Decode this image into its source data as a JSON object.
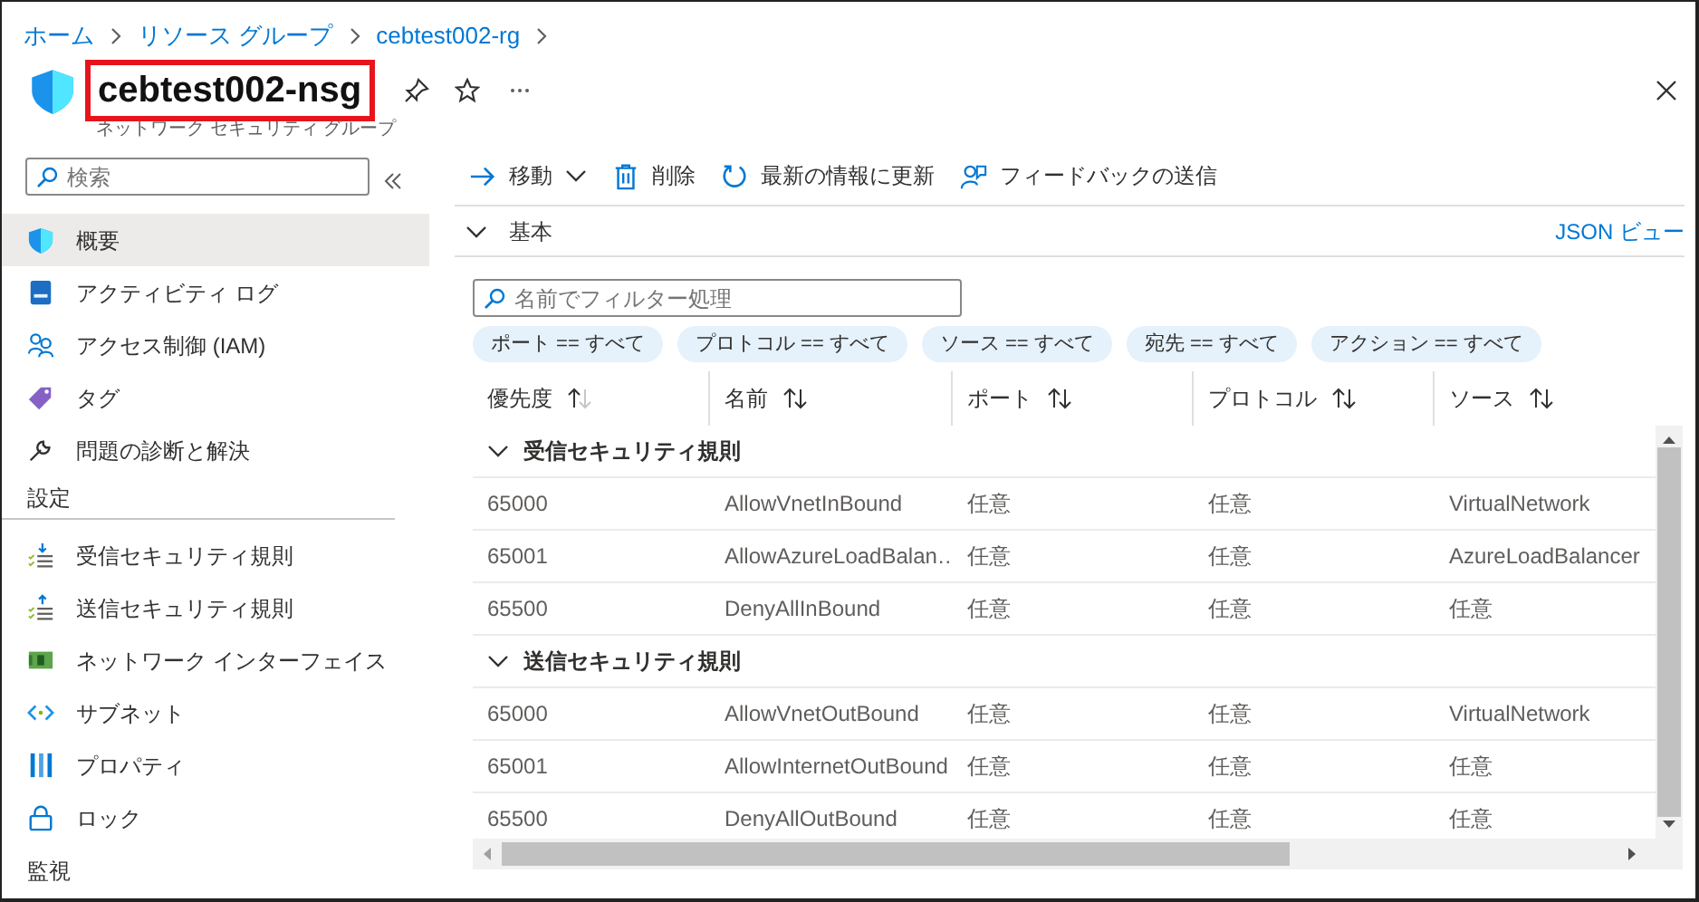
{
  "breadcrumb": [
    "ホーム",
    "リソース グループ",
    "cebtest002-rg"
  ],
  "header": {
    "title": "cebtest002-nsg",
    "subtitle": "ネットワーク セキュリティ グループ",
    "highlighted": true
  },
  "sidebar": {
    "search": {
      "placeholder": "検索"
    },
    "items": [
      {
        "kind": "item",
        "label": "概要",
        "selected": true
      },
      {
        "kind": "item",
        "label": "アクティビティ ログ",
        "selected": false
      },
      {
        "kind": "item",
        "label": "アクセス制御 (IAM)",
        "selected": false
      },
      {
        "kind": "item",
        "label": "タグ",
        "selected": false
      },
      {
        "kind": "item",
        "label": "問題の診断と解決",
        "selected": false
      },
      {
        "kind": "section",
        "label": "設定"
      },
      {
        "kind": "item",
        "label": "受信セキュリティ規則",
        "selected": false
      },
      {
        "kind": "item",
        "label": "送信セキュリティ規則",
        "selected": false
      },
      {
        "kind": "item",
        "label": "ネットワーク インターフェイス",
        "selected": false
      },
      {
        "kind": "item",
        "label": "サブネット",
        "selected": false
      },
      {
        "kind": "item",
        "label": "プロパティ",
        "selected": false
      },
      {
        "kind": "item",
        "label": "ロック",
        "selected": false
      },
      {
        "kind": "section",
        "label": "監視"
      }
    ]
  },
  "toolbar": [
    {
      "label": "移動",
      "dropdown": true
    },
    {
      "label": "削除",
      "dropdown": false
    },
    {
      "label": "最新の情報に更新",
      "dropdown": false
    },
    {
      "label": "フィードバックの送信",
      "dropdown": false
    }
  ],
  "essentials": {
    "label": "基本",
    "expanded": true,
    "json_link": "JSON ビュー"
  },
  "filter": {
    "placeholder": "名前でフィルター処理"
  },
  "filter_pills": [
    "ポート == すべて",
    "プロトコル == すべて",
    "ソース == すべて",
    "宛先 == すべて",
    "アクション == すべて"
  ],
  "table": {
    "columns": [
      {
        "label": "優先度",
        "sorted": true
      },
      {
        "label": "名前",
        "sorted": false
      },
      {
        "label": "ポート",
        "sorted": false
      },
      {
        "label": "プロトコル",
        "sorted": false
      },
      {
        "label": "ソース",
        "sorted": false
      }
    ],
    "groups": [
      {
        "label": "受信セキュリティ規則",
        "expanded": true,
        "rows": [
          [
            "65000",
            "AllowVnetInBound",
            "任意",
            "任意",
            "VirtualNetwork"
          ],
          [
            "65001",
            "AllowAzureLoadBalan…",
            "任意",
            "任意",
            "AzureLoadBalancer"
          ],
          [
            "65500",
            "DenyAllInBound",
            "任意",
            "任意",
            "任意"
          ]
        ]
      },
      {
        "label": "送信セキュリティ規則",
        "expanded": true,
        "rows": [
          [
            "65000",
            "AllowVnetOutBound",
            "任意",
            "任意",
            "VirtualNetwork"
          ],
          [
            "65001",
            "AllowInternetOutBound",
            "任意",
            "任意",
            "任意"
          ],
          [
            "65500",
            "DenyAllOutBound",
            "任意",
            "任意",
            "任意"
          ]
        ]
      }
    ]
  }
}
